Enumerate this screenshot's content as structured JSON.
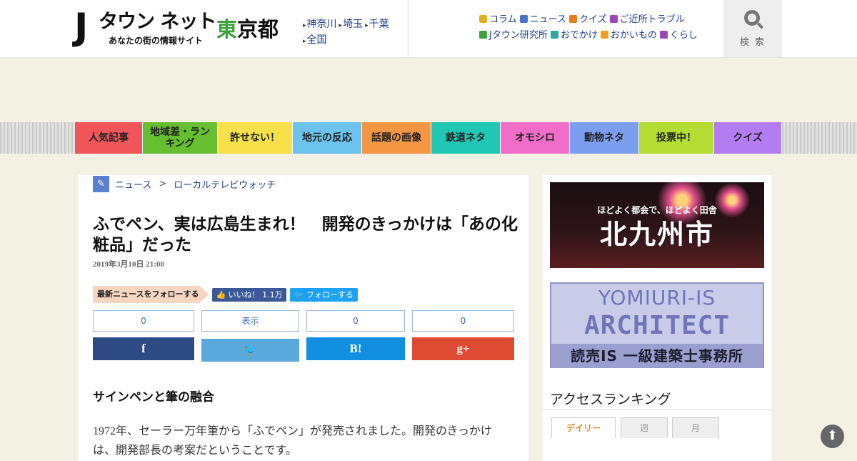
{
  "header": {
    "logo_j": "J",
    "logo_text": "タウン ネット",
    "logo_sub": "あなたの街の情報サイト",
    "prefecture_accent": "東",
    "prefecture_rest": "京都",
    "regions": [
      "神奈川",
      "埼玉",
      "千葉",
      "全国"
    ],
    "nav": [
      {
        "label": "コラム",
        "icon": "column-icon",
        "color": "#e0b020"
      },
      {
        "label": "ニュース",
        "icon": "pen-icon",
        "color": "#4a73c8"
      },
      {
        "label": "クイズ",
        "icon": "quiz-icon",
        "color": "#e87c1e"
      },
      {
        "label": "ご近所トラブル",
        "icon": "house-icon",
        "color": "#9b47b8"
      },
      {
        "label": "Jタウン研究所",
        "icon": "flask-icon",
        "color": "#3ea23a"
      },
      {
        "label": "おでかけ",
        "icon": "car-icon",
        "color": "#2ba6a0"
      },
      {
        "label": "おかいもの",
        "icon": "bag-icon",
        "color": "#f0a020"
      },
      {
        "label": "くらし",
        "icon": "home-icon",
        "color": "#9b47b8"
      }
    ],
    "search_label": "検 索"
  },
  "categories": [
    {
      "label": "人気記事",
      "color": "#f0555a"
    },
    {
      "label": "地域差・ランキング",
      "color": "#66bf30"
    },
    {
      "label": "許せない！",
      "color": "#f7e04a"
    },
    {
      "label": "地元の反応",
      "color": "#6cc4ee"
    },
    {
      "label": "話題の画像",
      "color": "#f59642"
    },
    {
      "label": "鉄道ネタ",
      "color": "#1fc7b4"
    },
    {
      "label": "オモシロ",
      "color": "#f06dc8"
    },
    {
      "label": "動物ネタ",
      "color": "#7c9ef0"
    },
    {
      "label": "投票中！",
      "color": "#b4dc32"
    },
    {
      "label": "クイズ",
      "color": "#b37cf0"
    }
  ],
  "article": {
    "breadcrumb": [
      "ニュース",
      "ローカルテレビウォッチ"
    ],
    "breadcrumb_sep": ">",
    "title": "ふでペン、実は広島生まれ！　開発のきっかけは「あの化粧品」だった",
    "date": "2019年3月10日 21:00",
    "follow_label": "最新ニュースをフォローする",
    "fb_like_label": "いいね！ 1.1万",
    "tw_follow_label": "フォローする",
    "share_counts": [
      "0",
      "表示",
      "0",
      "0"
    ],
    "share_buttons": [
      {
        "label": "f",
        "name": "facebook-share-button",
        "color": "#2d4a85"
      },
      {
        "label": "🐦",
        "name": "twitter-share-button",
        "color": "#5aa9dc"
      },
      {
        "label": "B!",
        "name": "hatena-share-button",
        "color": "#118ee0"
      },
      {
        "label": "g+",
        "name": "googleplus-share-button",
        "color": "#df4a32"
      }
    ],
    "subheading": "サインペンと筆の融合",
    "body": "1972年、セーラー万年筆から「ふでペン」が発売されました。開発のきっかけは、開発部長の考案だということです。"
  },
  "sidebar": {
    "ad1": {
      "line1": "ほどよく都会で、ほどよく田舎",
      "line2": "北九州市"
    },
    "ad2": {
      "line1": "YOMIURI-IS",
      "line2": "ARCHITECT",
      "line3": "読売IS 一級建築士事務所"
    },
    "ranking_title": "アクセスランキング",
    "ranking_tabs": [
      "デイリー",
      "週",
      "月"
    ],
    "active_tab": "デイリー"
  },
  "totop_icon": "arrow-up-icon"
}
